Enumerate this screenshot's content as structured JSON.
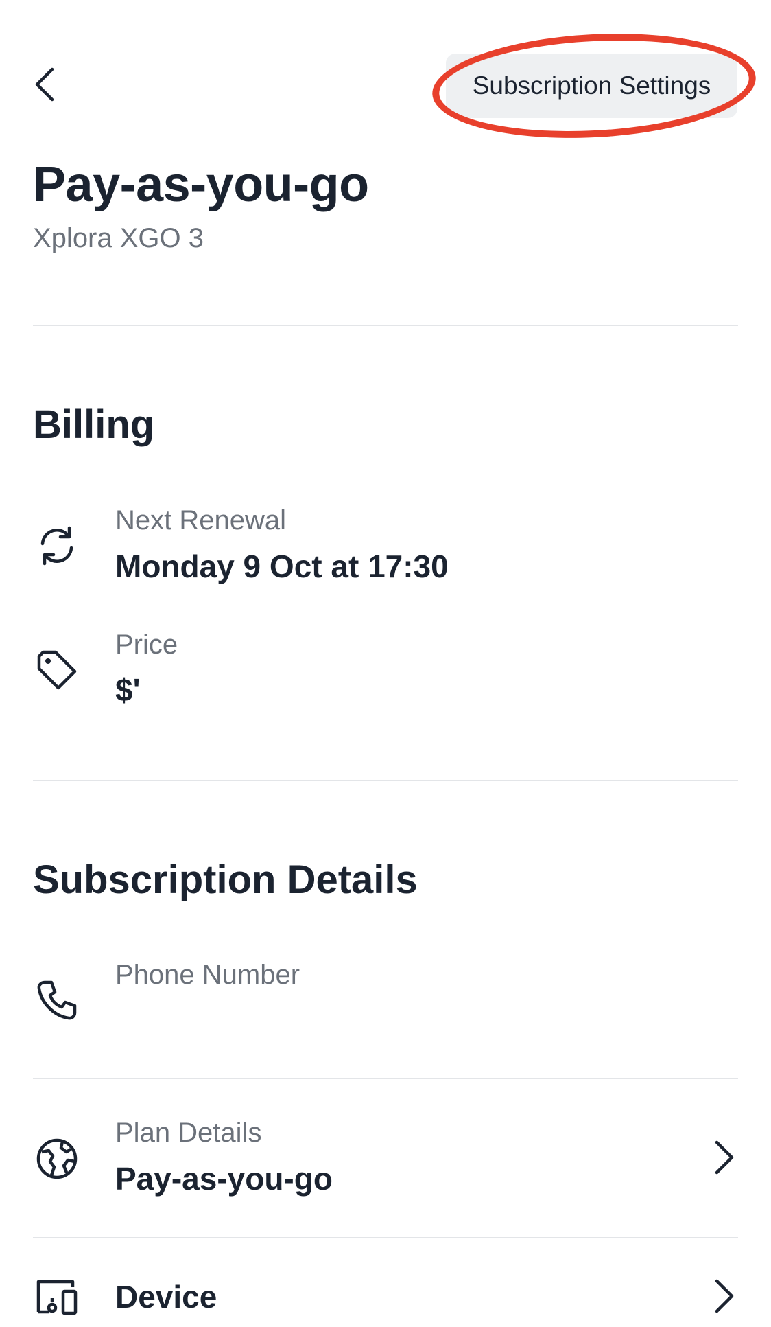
{
  "header": {
    "back_icon": "chevron-left-icon",
    "settings_label": "Subscription Settings",
    "highlight_color": "#e8402c"
  },
  "plan": {
    "title": "Pay-as-you-go",
    "device_name": "Xplora XGO 3"
  },
  "billing": {
    "heading": "Billing",
    "next_renewal": {
      "icon": "refresh-icon",
      "label": "Next Renewal",
      "value": "Monday 9 Oct at 17:30"
    },
    "price": {
      "icon": "tag-icon",
      "label": "Price",
      "value": "$'"
    }
  },
  "details": {
    "heading": "Subscription Details",
    "phone": {
      "icon": "phone-icon",
      "label": "Phone Number",
      "value": ""
    },
    "plan_details": {
      "icon": "globe-icon",
      "label": "Plan Details",
      "value": "Pay-as-you-go",
      "chevron_icon": "chevron-right-icon"
    },
    "device": {
      "icon": "device-icon",
      "label": "Device",
      "chevron_icon": "chevron-right-icon"
    }
  },
  "colors": {
    "text_primary": "#1b2330",
    "text_secondary": "#6b717a",
    "divider": "#e3e5e8",
    "button_bg": "#eef0f2"
  }
}
